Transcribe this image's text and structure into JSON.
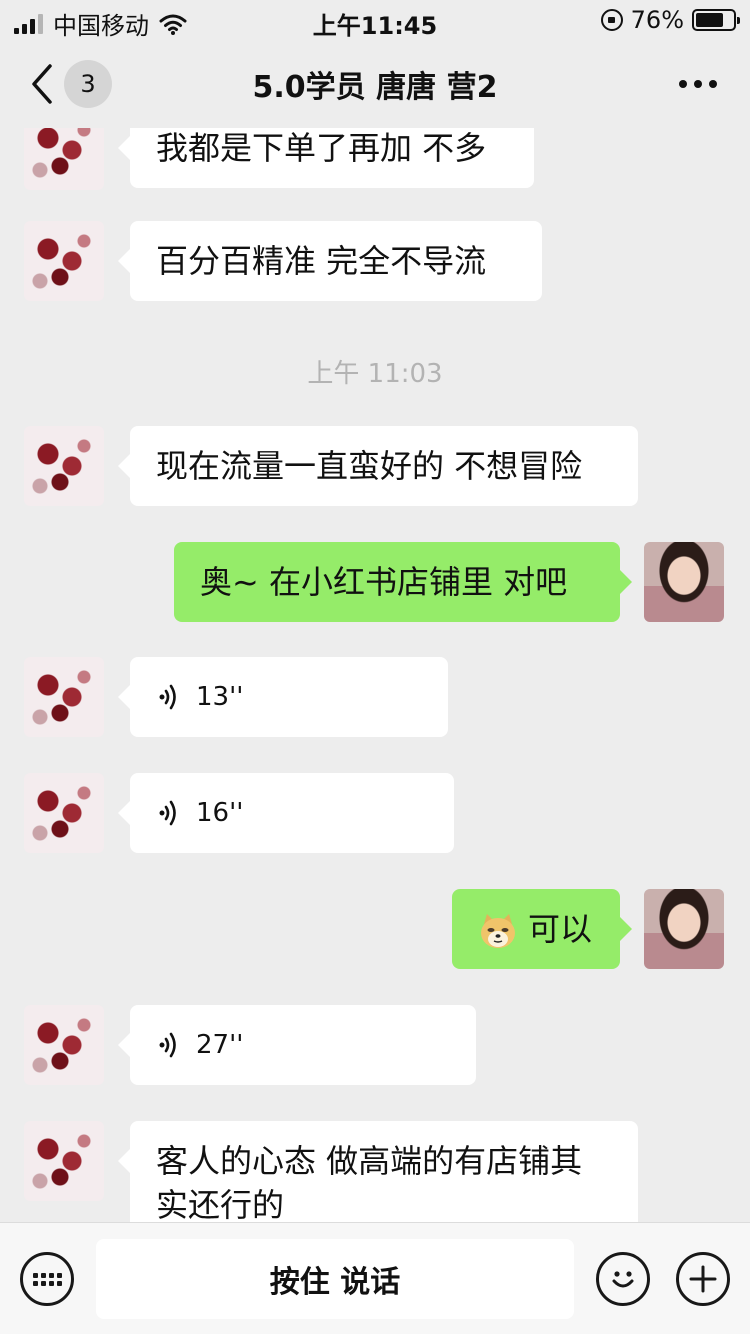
{
  "status_bar": {
    "carrier": "中国移动",
    "time": "上午11:45",
    "battery_percent": "76%",
    "battery_level": 0.76
  },
  "nav": {
    "unread_count": "3",
    "title": "5.0学员 唐唐 营2"
  },
  "messages": [
    {
      "side": "in",
      "type": "text",
      "text": "我都是下单了再加 不多"
    },
    {
      "side": "in",
      "type": "text",
      "text": "百分百精准 完全不导流"
    },
    {
      "type": "timestamp",
      "text": "上午 11:03"
    },
    {
      "side": "in",
      "type": "text",
      "text": "现在流量一直蛮好的 不想冒险"
    },
    {
      "side": "out",
      "type": "text",
      "text": "奥~ 在小红书店铺里 对吧"
    },
    {
      "side": "in",
      "type": "voice",
      "duration": "13''"
    },
    {
      "side": "in",
      "type": "voice",
      "duration": "16''"
    },
    {
      "side": "out",
      "type": "emoji_text",
      "emoji": "doge-emoji",
      "text": "可以"
    },
    {
      "side": "in",
      "type": "voice",
      "duration": "27''"
    },
    {
      "side": "in",
      "type": "text",
      "text": "客人的心态 做高端的有店铺其实还行的"
    }
  ],
  "input_bar": {
    "hold_to_talk_label": "按住 说话",
    "icons": [
      "keyboard-icon",
      "emoji-icon",
      "plus-icon"
    ]
  },
  "colors": {
    "background": "#ededed",
    "incoming_bubble": "#ffffff",
    "outgoing_bubble": "#95ec69",
    "timestamp_text": "#b3b3b3"
  }
}
